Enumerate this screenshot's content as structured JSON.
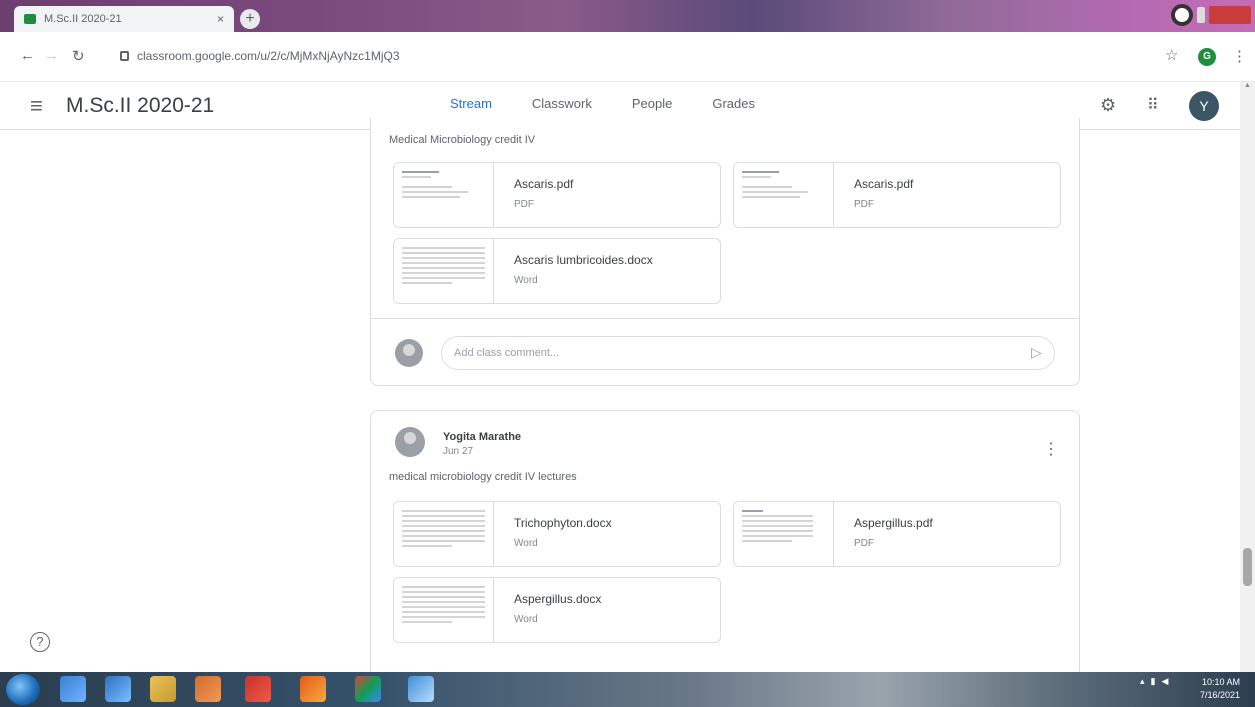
{
  "browser": {
    "tab_title": "M.Sc.II 2020-21",
    "url": "classroom.google.com/u/2/c/MjMxNjAyNzc1MjQ3",
    "profile_initial": "G"
  },
  "header": {
    "class_title": "M.Sc.II 2020-21",
    "tabs": [
      {
        "label": "Stream",
        "active": true
      },
      {
        "label": "Classwork"
      },
      {
        "label": "People"
      },
      {
        "label": "Grades"
      }
    ],
    "avatar_initial": "Y"
  },
  "posts": [
    {
      "description": "Medical Microbiology credit IV",
      "attachments": [
        {
          "name": "Ascaris.pdf",
          "type": "PDF"
        },
        {
          "name": "Ascaris.pdf",
          "type": "PDF"
        },
        {
          "name": "Ascaris lumbricoides.docx",
          "type": "Word"
        }
      ],
      "comment_placeholder": "Add class comment..."
    },
    {
      "author": "Yogita Marathe",
      "date": "Jun 27",
      "description": "medical microbiology credit IV lectures",
      "attachments": [
        {
          "name": "Trichophyton.docx",
          "type": "Word"
        },
        {
          "name": "Aspergillus.pdf",
          "type": "PDF"
        },
        {
          "name": "Aspergillus.docx",
          "type": "Word"
        }
      ]
    }
  ],
  "taskbar": {
    "time": "10:10 AM",
    "date": "7/16/2021"
  },
  "colors": {
    "accent_tab": "#1a73e8",
    "tab_underline": "#1e8e3e",
    "avatar": "#3c5666"
  }
}
